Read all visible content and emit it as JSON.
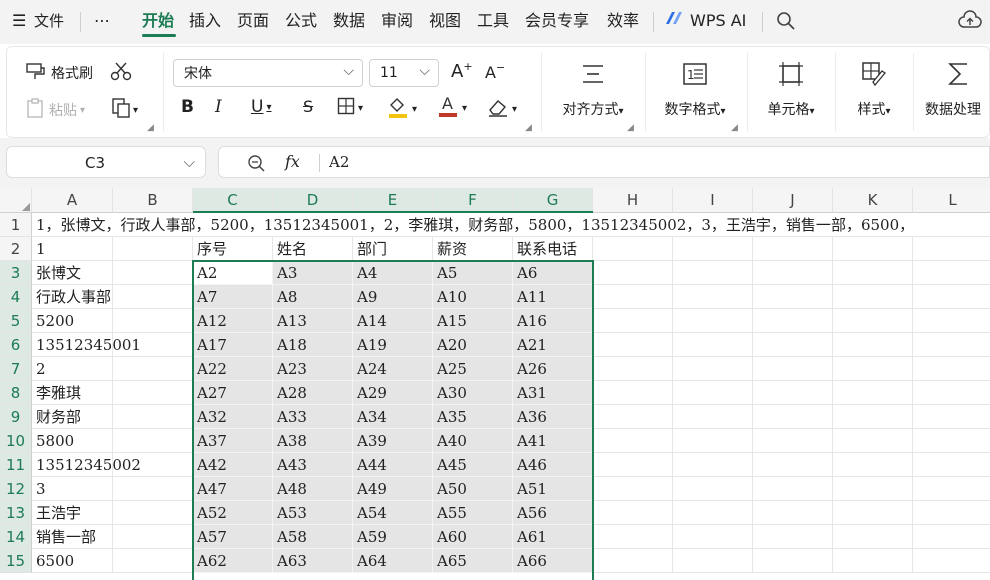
{
  "menubar": {
    "hamburger": "☰",
    "file_label": "文件",
    "more": "⋯",
    "tabs": [
      "开始",
      "插入",
      "页面",
      "公式",
      "数据",
      "审阅",
      "视图",
      "工具",
      "会员专享",
      "效率"
    ],
    "wps_ai": "WPS AI"
  },
  "ribbon": {
    "format_painter": "格式刷",
    "paste": "粘贴",
    "font_name": "宋体",
    "font_size": "11",
    "bold": "B",
    "italic": "I",
    "underline": "U",
    "strike": "S",
    "align": "对齐方式",
    "number_format": "数字格式",
    "cell": "单元格",
    "style": "样式",
    "data_processing": "数据处理"
  },
  "formula_bar": {
    "name_box": "C3",
    "fx": "fx",
    "content": "A2"
  },
  "colors": {
    "accent": "#1c7c54",
    "font_color": "#c0392b",
    "fill_color": "#f1c40f"
  },
  "sheet": {
    "columns": [
      "A",
      "B",
      "C",
      "D",
      "E",
      "F",
      "G",
      "H",
      "I",
      "J",
      "K",
      "L"
    ],
    "rows": [
      "1",
      "2",
      "3",
      "4",
      "5",
      "6",
      "7",
      "8",
      "9",
      "10",
      "11",
      "12",
      "13",
      "14",
      "15"
    ],
    "row1_text": "1，张博文，行政人事部，5200，13512345001，2，李雅琪，财务部，5800，13512345002，3，王浩宇，销售一部，6500，",
    "col_a": [
      "1",
      "张博文",
      "行政人事部",
      "5200",
      "13512345001",
      "2",
      "李雅琪",
      "财务部",
      "5800",
      "13512345002",
      "3",
      "王浩宇",
      "销售一部",
      "6500"
    ],
    "header_row": [
      "序号",
      "姓名",
      "部门",
      "薪资",
      "联系电话"
    ],
    "table": [
      [
        "A2",
        "A3",
        "A4",
        "A5",
        "A6"
      ],
      [
        "A7",
        "A8",
        "A9",
        "A10",
        "A11"
      ],
      [
        "A12",
        "A13",
        "A14",
        "A15",
        "A16"
      ],
      [
        "A17",
        "A18",
        "A19",
        "A20",
        "A21"
      ],
      [
        "A22",
        "A23",
        "A24",
        "A25",
        "A26"
      ],
      [
        "A27",
        "A28",
        "A29",
        "A30",
        "A31"
      ],
      [
        "A32",
        "A33",
        "A34",
        "A35",
        "A36"
      ],
      [
        "A37",
        "A38",
        "A39",
        "A40",
        "A41"
      ],
      [
        "A42",
        "A43",
        "A44",
        "A45",
        "A46"
      ],
      [
        "A47",
        "A48",
        "A49",
        "A50",
        "A51"
      ],
      [
        "A52",
        "A53",
        "A54",
        "A55",
        "A56"
      ],
      [
        "A57",
        "A58",
        "A59",
        "A60",
        "A61"
      ],
      [
        "A62",
        "A63",
        "A64",
        "A65",
        "A66"
      ]
    ]
  }
}
